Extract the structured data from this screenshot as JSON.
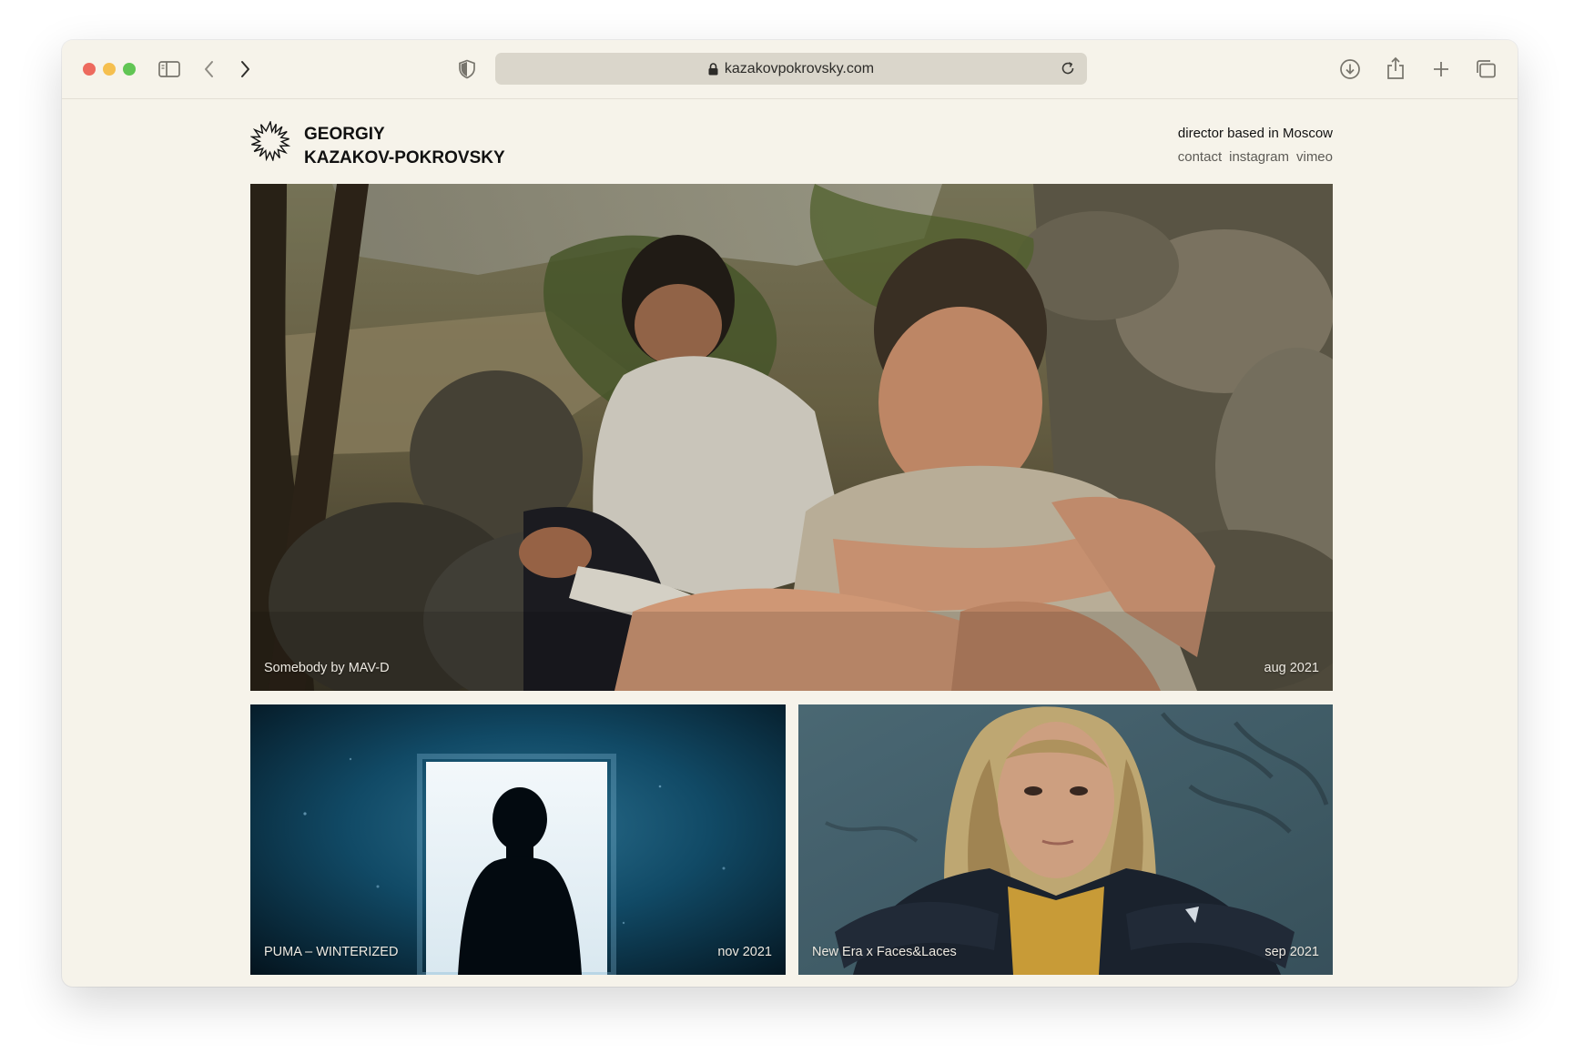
{
  "browser": {
    "url": "kazakovpokrovsky.com",
    "icons": [
      "sidebar-icon",
      "back-chevron-icon",
      "forward-chevron-icon",
      "shield-icon",
      "lock-icon",
      "reload-icon",
      "download-icon",
      "share-icon",
      "new-tab-plus-icon",
      "tabs-overview-icon"
    ],
    "traffic_lights": {
      "close": "#ed6a5e",
      "minimize": "#f5bf4f",
      "zoom": "#61c554"
    }
  },
  "site": {
    "name_line1": "GEORGIY",
    "name_line2": "KAZAKOV-POKROVSKY",
    "tagline": "director based in Moscow",
    "links": [
      "contact",
      "instagram",
      "vimeo"
    ],
    "background": "#f6f3ea"
  },
  "projects": [
    {
      "title": "Somebody by MAV-D",
      "date": "aug 2021"
    },
    {
      "title": "PUMA – WINTERIZED",
      "date": "nov 2021"
    },
    {
      "title": "New Era x Faces&Laces",
      "date": "sep 2021"
    }
  ]
}
